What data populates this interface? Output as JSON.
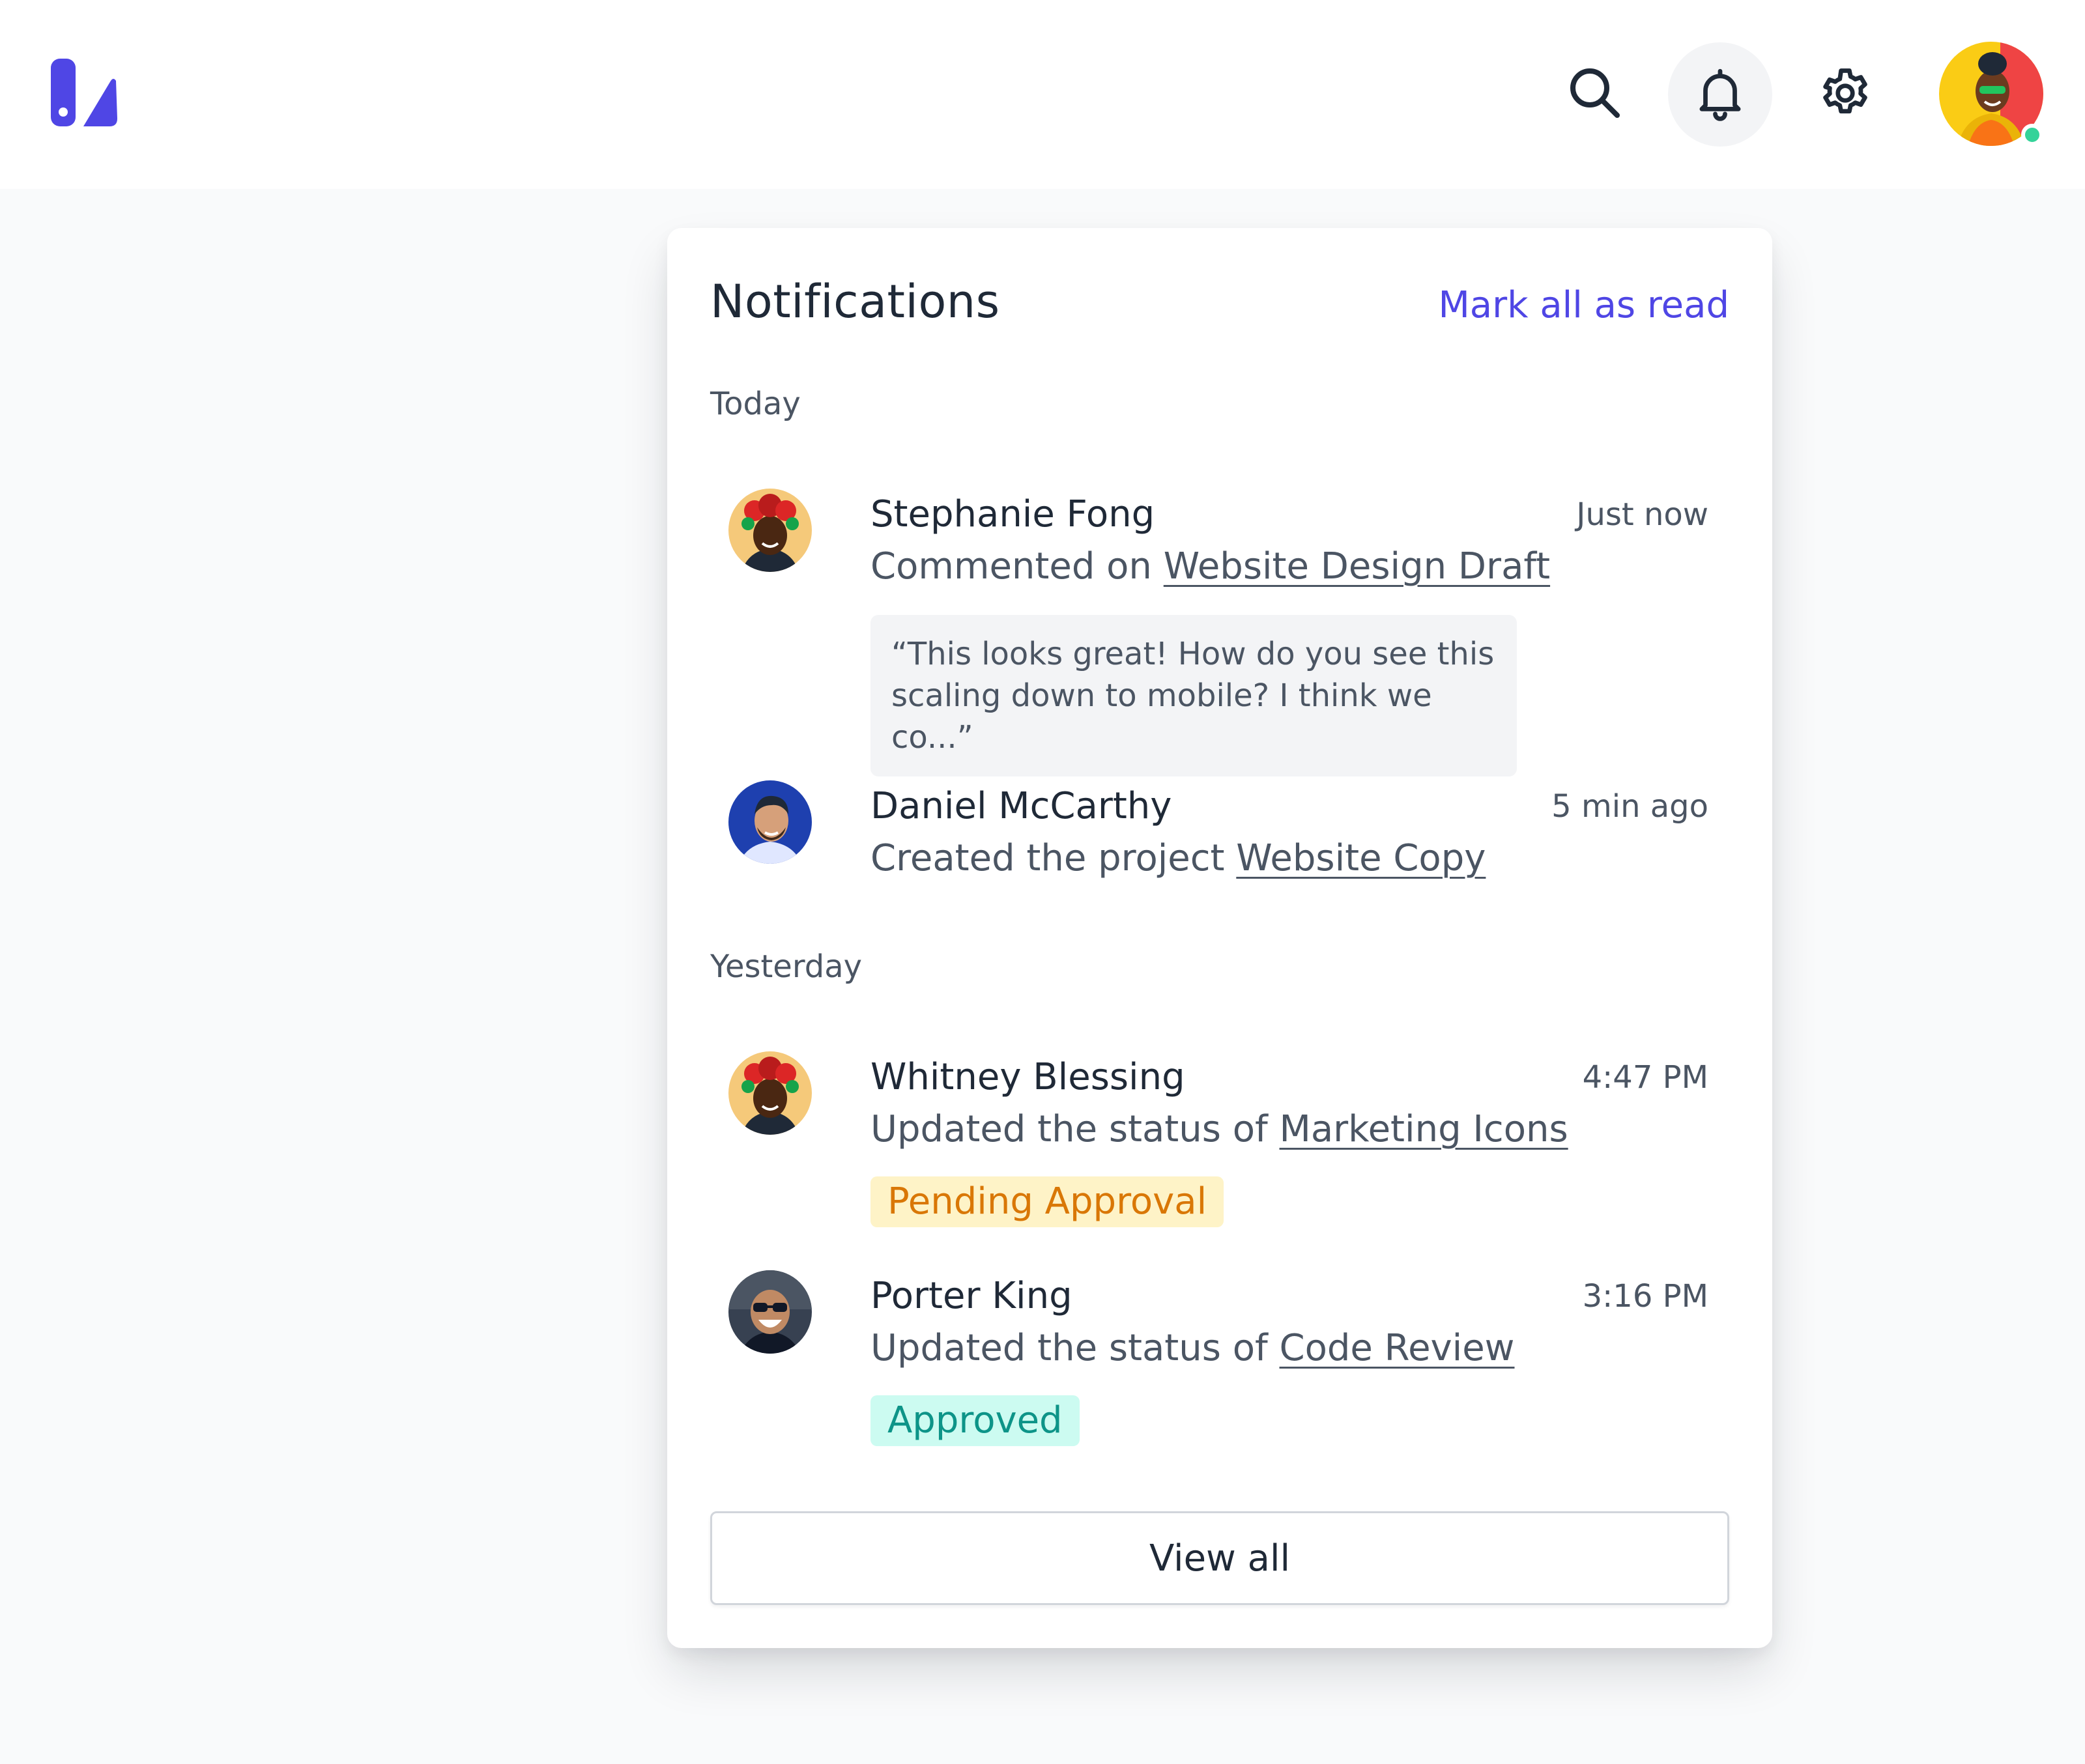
{
  "header": {
    "logo_icon": "brand-logo-icon",
    "search_icon": "search-icon",
    "bell_icon": "bell-icon",
    "settings_icon": "gear-icon",
    "user_status": "online",
    "brand_color": "#4f46e5"
  },
  "notifications": {
    "title": "Notifications",
    "mark_all_label": "Mark all as read",
    "sections": [
      {
        "label": "Today",
        "items": [
          {
            "name": "Stephanie Fong",
            "time": "Just now",
            "action_text": "Commented on ",
            "link_text": "Website Design Draft",
            "quote": "“This looks great! How do you see this scaling down to mobile? I think we co...”"
          },
          {
            "name": "Daniel McCarthy",
            "time": "5 min ago",
            "action_text": "Created the project ",
            "link_text": "Website Copy"
          }
        ]
      },
      {
        "label": "Yesterday",
        "items": [
          {
            "name": "Whitney Blessing",
            "time": "4:47 PM",
            "action_text": "Updated the status of ",
            "link_text": "Marketing Icons",
            "badge": "Pending Approval"
          },
          {
            "name": "Porter King",
            "time": "3:16 PM",
            "action_text": "Updated the status of ",
            "link_text": "Code Review",
            "badge": "Approved"
          }
        ]
      }
    ],
    "view_all_label": "View all",
    "status_colors": {
      "pending_bg": "#fef3c7",
      "pending_text": "#d97706",
      "approved_bg": "#ccfbf1",
      "approved_text": "#0d9488"
    }
  }
}
